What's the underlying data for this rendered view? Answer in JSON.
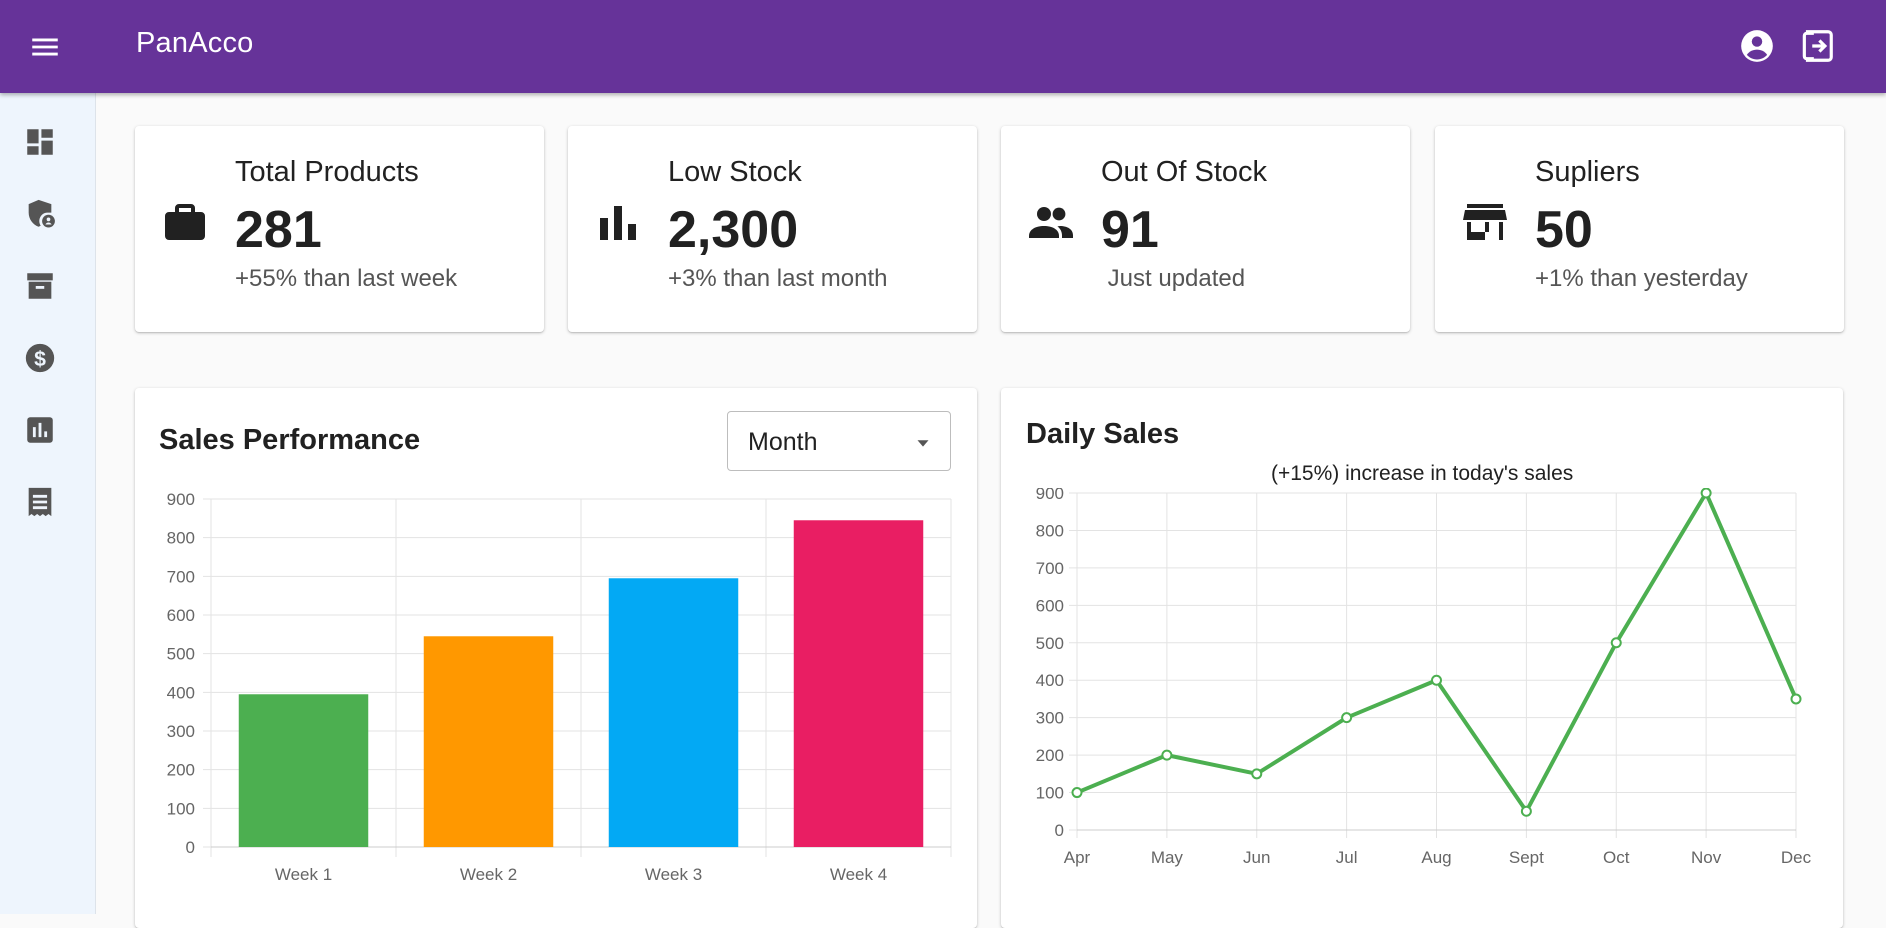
{
  "app": {
    "title": "PanAcco"
  },
  "icons": {
    "menu": "menu-icon",
    "account": "account-circle-icon",
    "logout": "logout-icon",
    "sidebar": [
      "dashboard-icon",
      "shield-user-icon",
      "archive-icon",
      "dollar-icon",
      "bar-chart-icon",
      "receipt-icon"
    ]
  },
  "stats": [
    {
      "label": "Total Products",
      "value": "281",
      "sub": "+55% than last week",
      "icon": "briefcase-icon"
    },
    {
      "label": "Low Stock",
      "value": "2,300",
      "sub": "+3% than last month",
      "icon": "bar-chart-icon"
    },
    {
      "label": "Out Of Stock",
      "value": "91",
      "sub": " Just updated",
      "icon": "people-icon"
    },
    {
      "label": "Supliers",
      "value": "50",
      "sub": "+1% than yesterday",
      "icon": "store-icon"
    }
  ],
  "sales": {
    "title": "Sales Performance",
    "period_select": "Month"
  },
  "daily": {
    "title": "Daily Sales",
    "subtitle": "(+15%) increase in today's sales"
  },
  "colors": {
    "appbar": "#663399",
    "line": "#4caf50",
    "bars": [
      "#4caf50",
      "#ff9800",
      "#03a9f4",
      "#e91e63"
    ]
  },
  "chart_data": [
    {
      "type": "bar",
      "categories": [
        "Week 1",
        "Week 2",
        "Week 3",
        "Week 4"
      ],
      "values": [
        395,
        545,
        695,
        845
      ],
      "ylim": [
        0,
        900
      ],
      "yticks": [
        0,
        100,
        200,
        300,
        400,
        500,
        600,
        700,
        800,
        900
      ],
      "grid": true
    },
    {
      "type": "line",
      "categories": [
        "Apr",
        "May",
        "Jun",
        "Jul",
        "Aug",
        "Sept",
        "Oct",
        "Nov",
        "Dec"
      ],
      "values": [
        100,
        200,
        150,
        300,
        400,
        50,
        500,
        900,
        350
      ],
      "ylim": [
        0,
        900
      ],
      "yticks": [
        0,
        100,
        200,
        300,
        400,
        500,
        600,
        700,
        800,
        900
      ],
      "grid": true
    }
  ]
}
